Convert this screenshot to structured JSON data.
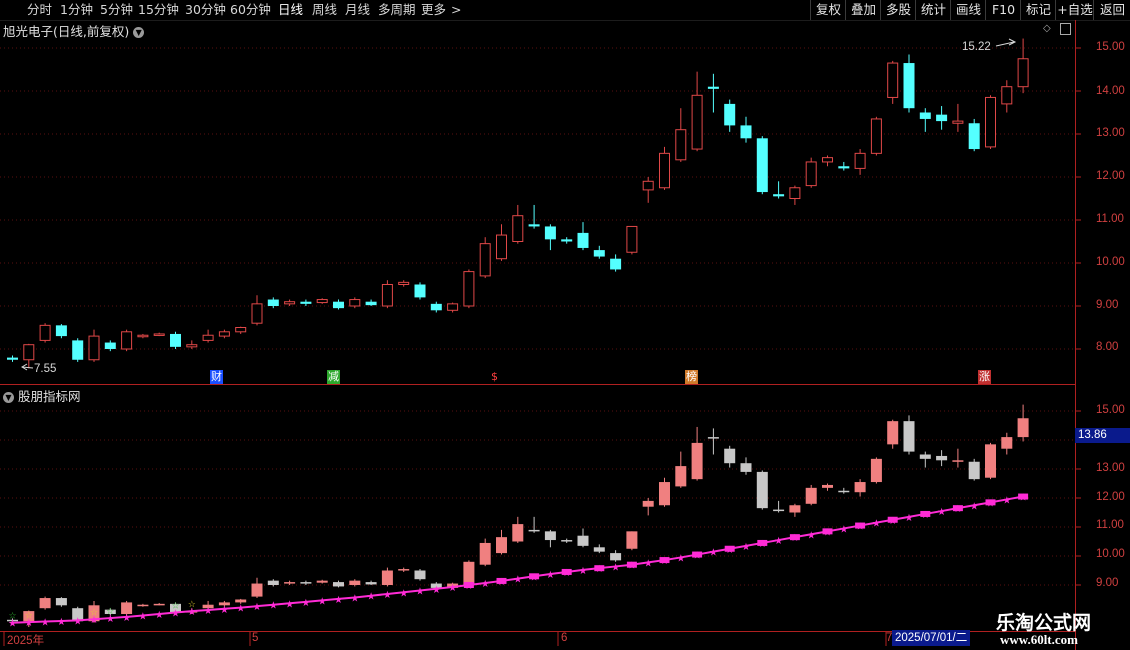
{
  "toolbar": {
    "tabs": [
      "分时",
      "1分钟",
      "5分钟",
      "15分钟",
      "30分钟",
      "60分钟",
      "日线",
      "周线",
      "月线",
      "多周期",
      "更多"
    ],
    "active_tab": "日线",
    "right_buttons": [
      "复权",
      "叠加",
      "多股",
      "统计",
      "画线",
      "F10",
      "标记",
      "+自选",
      "返回"
    ]
  },
  "main_chart": {
    "title": "旭光电子(日线,前复权)",
    "high_label": "15.22",
    "low_label": "7.55",
    "y_ticks": [
      "15.00",
      "14.00",
      "13.00",
      "12.00",
      "11.00",
      "10.00",
      "9.00",
      "8.00"
    ],
    "events": [
      "财",
      "减",
      "$",
      "榜",
      "涨"
    ]
  },
  "sub_chart": {
    "title": "股朋指标网",
    "y_ticks": [
      "15.00",
      "14.00",
      "13.00",
      "12.00",
      "11.00",
      "10.00",
      "9.00"
    ],
    "current_value": "13.86"
  },
  "timeline": {
    "labels": [
      "2025年",
      "5",
      "6",
      "7"
    ],
    "cursor_date": "2025/07/01/二"
  },
  "watermark": {
    "line1": "乐淘公式网",
    "line2": "www.60lt.com"
  },
  "colors": {
    "up": "#e04848",
    "down_main": "#54ffff",
    "down_sub": "#c8c8c8",
    "up_fill_sub": "#f08080",
    "ma": "#ff2bd6",
    "axis": "#b02020"
  },
  "chart_data": {
    "type": "candlestick",
    "ylim_main": [
      7.5,
      15.4
    ],
    "candles": [
      [
        7.75,
        7.8,
        7.7,
        7.85,
        "down"
      ],
      [
        7.75,
        8.1,
        7.55,
        8.12,
        "up"
      ],
      [
        8.2,
        8.55,
        8.15,
        8.6,
        "up"
      ],
      [
        8.55,
        8.3,
        8.25,
        8.58,
        "down"
      ],
      [
        8.2,
        7.75,
        7.7,
        8.25,
        "down"
      ],
      [
        7.75,
        8.3,
        7.7,
        8.45,
        "up"
      ],
      [
        8.15,
        8.0,
        7.95,
        8.2,
        "down"
      ],
      [
        8.0,
        8.4,
        7.95,
        8.45,
        "up"
      ],
      [
        8.3,
        8.32,
        8.25,
        8.35,
        "up"
      ],
      [
        8.35,
        8.35,
        8.3,
        8.38,
        "up"
      ],
      [
        8.35,
        8.05,
        8.0,
        8.4,
        "down"
      ],
      [
        8.05,
        8.1,
        8.0,
        8.2,
        "up"
      ],
      [
        8.2,
        8.32,
        8.15,
        8.45,
        "up"
      ],
      [
        8.3,
        8.4,
        8.25,
        8.45,
        "up"
      ],
      [
        8.4,
        8.5,
        8.35,
        8.52,
        "up"
      ],
      [
        8.6,
        9.05,
        8.55,
        9.25,
        "up"
      ],
      [
        9.15,
        9.0,
        8.95,
        9.2,
        "down"
      ],
      [
        9.05,
        9.1,
        9.0,
        9.15,
        "up"
      ],
      [
        9.1,
        9.05,
        9.0,
        9.15,
        "down"
      ],
      [
        9.08,
        9.15,
        9.05,
        9.18,
        "up"
      ],
      [
        9.1,
        8.95,
        8.92,
        9.15,
        "down"
      ],
      [
        9.0,
        9.15,
        8.95,
        9.2,
        "up"
      ],
      [
        9.1,
        9.02,
        9.0,
        9.15,
        "down"
      ],
      [
        9.0,
        9.5,
        8.95,
        9.6,
        "up"
      ],
      [
        9.55,
        9.5,
        9.45,
        9.6,
        "up"
      ],
      [
        9.5,
        9.2,
        9.15,
        9.55,
        "down"
      ],
      [
        9.05,
        8.9,
        8.85,
        9.1,
        "down"
      ],
      [
        8.9,
        9.05,
        8.85,
        9.08,
        "up"
      ],
      [
        9.0,
        9.8,
        8.95,
        9.85,
        "up"
      ],
      [
        9.7,
        10.45,
        9.65,
        10.6,
        "up"
      ],
      [
        10.1,
        10.65,
        10.05,
        10.9,
        "up"
      ],
      [
        10.5,
        11.1,
        10.45,
        11.35,
        "up"
      ],
      [
        10.9,
        10.85,
        10.8,
        11.35,
        "down"
      ],
      [
        10.85,
        10.55,
        10.3,
        10.9,
        "down"
      ],
      [
        10.55,
        10.5,
        10.45,
        10.6,
        "down"
      ],
      [
        10.7,
        10.35,
        10.3,
        10.95,
        "down"
      ],
      [
        10.3,
        10.15,
        10.1,
        10.4,
        "down"
      ],
      [
        10.1,
        9.85,
        9.8,
        10.2,
        "down"
      ],
      [
        10.25,
        10.85,
        10.2,
        10.85,
        "up"
      ],
      [
        11.7,
        11.9,
        11.4,
        12.0,
        "up"
      ],
      [
        11.75,
        12.55,
        11.7,
        12.7,
        "up"
      ],
      [
        12.4,
        13.1,
        12.35,
        13.6,
        "up"
      ],
      [
        12.65,
        13.9,
        12.6,
        14.45,
        "up"
      ],
      [
        14.1,
        14.05,
        13.5,
        14.4,
        "down"
      ],
      [
        13.7,
        13.2,
        13.05,
        13.8,
        "down"
      ],
      [
        13.2,
        12.9,
        12.8,
        13.4,
        "down"
      ],
      [
        12.9,
        11.65,
        11.6,
        12.95,
        "down"
      ],
      [
        11.6,
        11.55,
        11.5,
        11.9,
        "down"
      ],
      [
        11.5,
        11.75,
        11.35,
        11.8,
        "up"
      ],
      [
        11.8,
        12.35,
        11.75,
        12.45,
        "up"
      ],
      [
        12.35,
        12.45,
        12.25,
        12.5,
        "up"
      ],
      [
        12.25,
        12.2,
        12.15,
        12.35,
        "down"
      ],
      [
        12.2,
        12.55,
        12.05,
        12.65,
        "up"
      ],
      [
        12.55,
        13.35,
        12.5,
        13.4,
        "up"
      ],
      [
        13.85,
        14.65,
        13.7,
        14.7,
        "up"
      ],
      [
        14.65,
        13.6,
        13.5,
        14.85,
        "down"
      ],
      [
        13.5,
        13.35,
        13.05,
        13.6,
        "down"
      ],
      [
        13.45,
        13.3,
        13.1,
        13.65,
        "down"
      ],
      [
        13.25,
        13.3,
        13.05,
        13.7,
        "up"
      ],
      [
        13.25,
        12.65,
        12.6,
        13.35,
        "down"
      ],
      [
        12.7,
        13.85,
        12.65,
        13.9,
        "up"
      ],
      [
        13.7,
        14.1,
        13.5,
        14.25,
        "up"
      ],
      [
        14.1,
        14.75,
        13.95,
        15.22,
        "up"
      ]
    ],
    "ma": [
      7.7,
      7.72,
      7.74,
      7.76,
      7.78,
      7.82,
      7.86,
      7.9,
      7.95,
      8.0,
      8.05,
      8.1,
      8.14,
      8.18,
      8.22,
      8.27,
      8.32,
      8.37,
      8.42,
      8.47,
      8.52,
      8.57,
      8.63,
      8.69,
      8.75,
      8.81,
      8.87,
      8.93,
      9.0,
      9.07,
      9.14,
      9.22,
      9.3,
      9.38,
      9.45,
      9.52,
      9.58,
      9.64,
      9.7,
      9.78,
      9.86,
      9.95,
      10.05,
      10.15,
      10.25,
      10.35,
      10.45,
      10.55,
      10.65,
      10.75,
      10.85,
      10.95,
      11.05,
      11.15,
      11.25,
      11.35,
      11.45,
      11.55,
      11.65,
      11.75,
      11.85,
      11.95,
      12.05
    ]
  }
}
